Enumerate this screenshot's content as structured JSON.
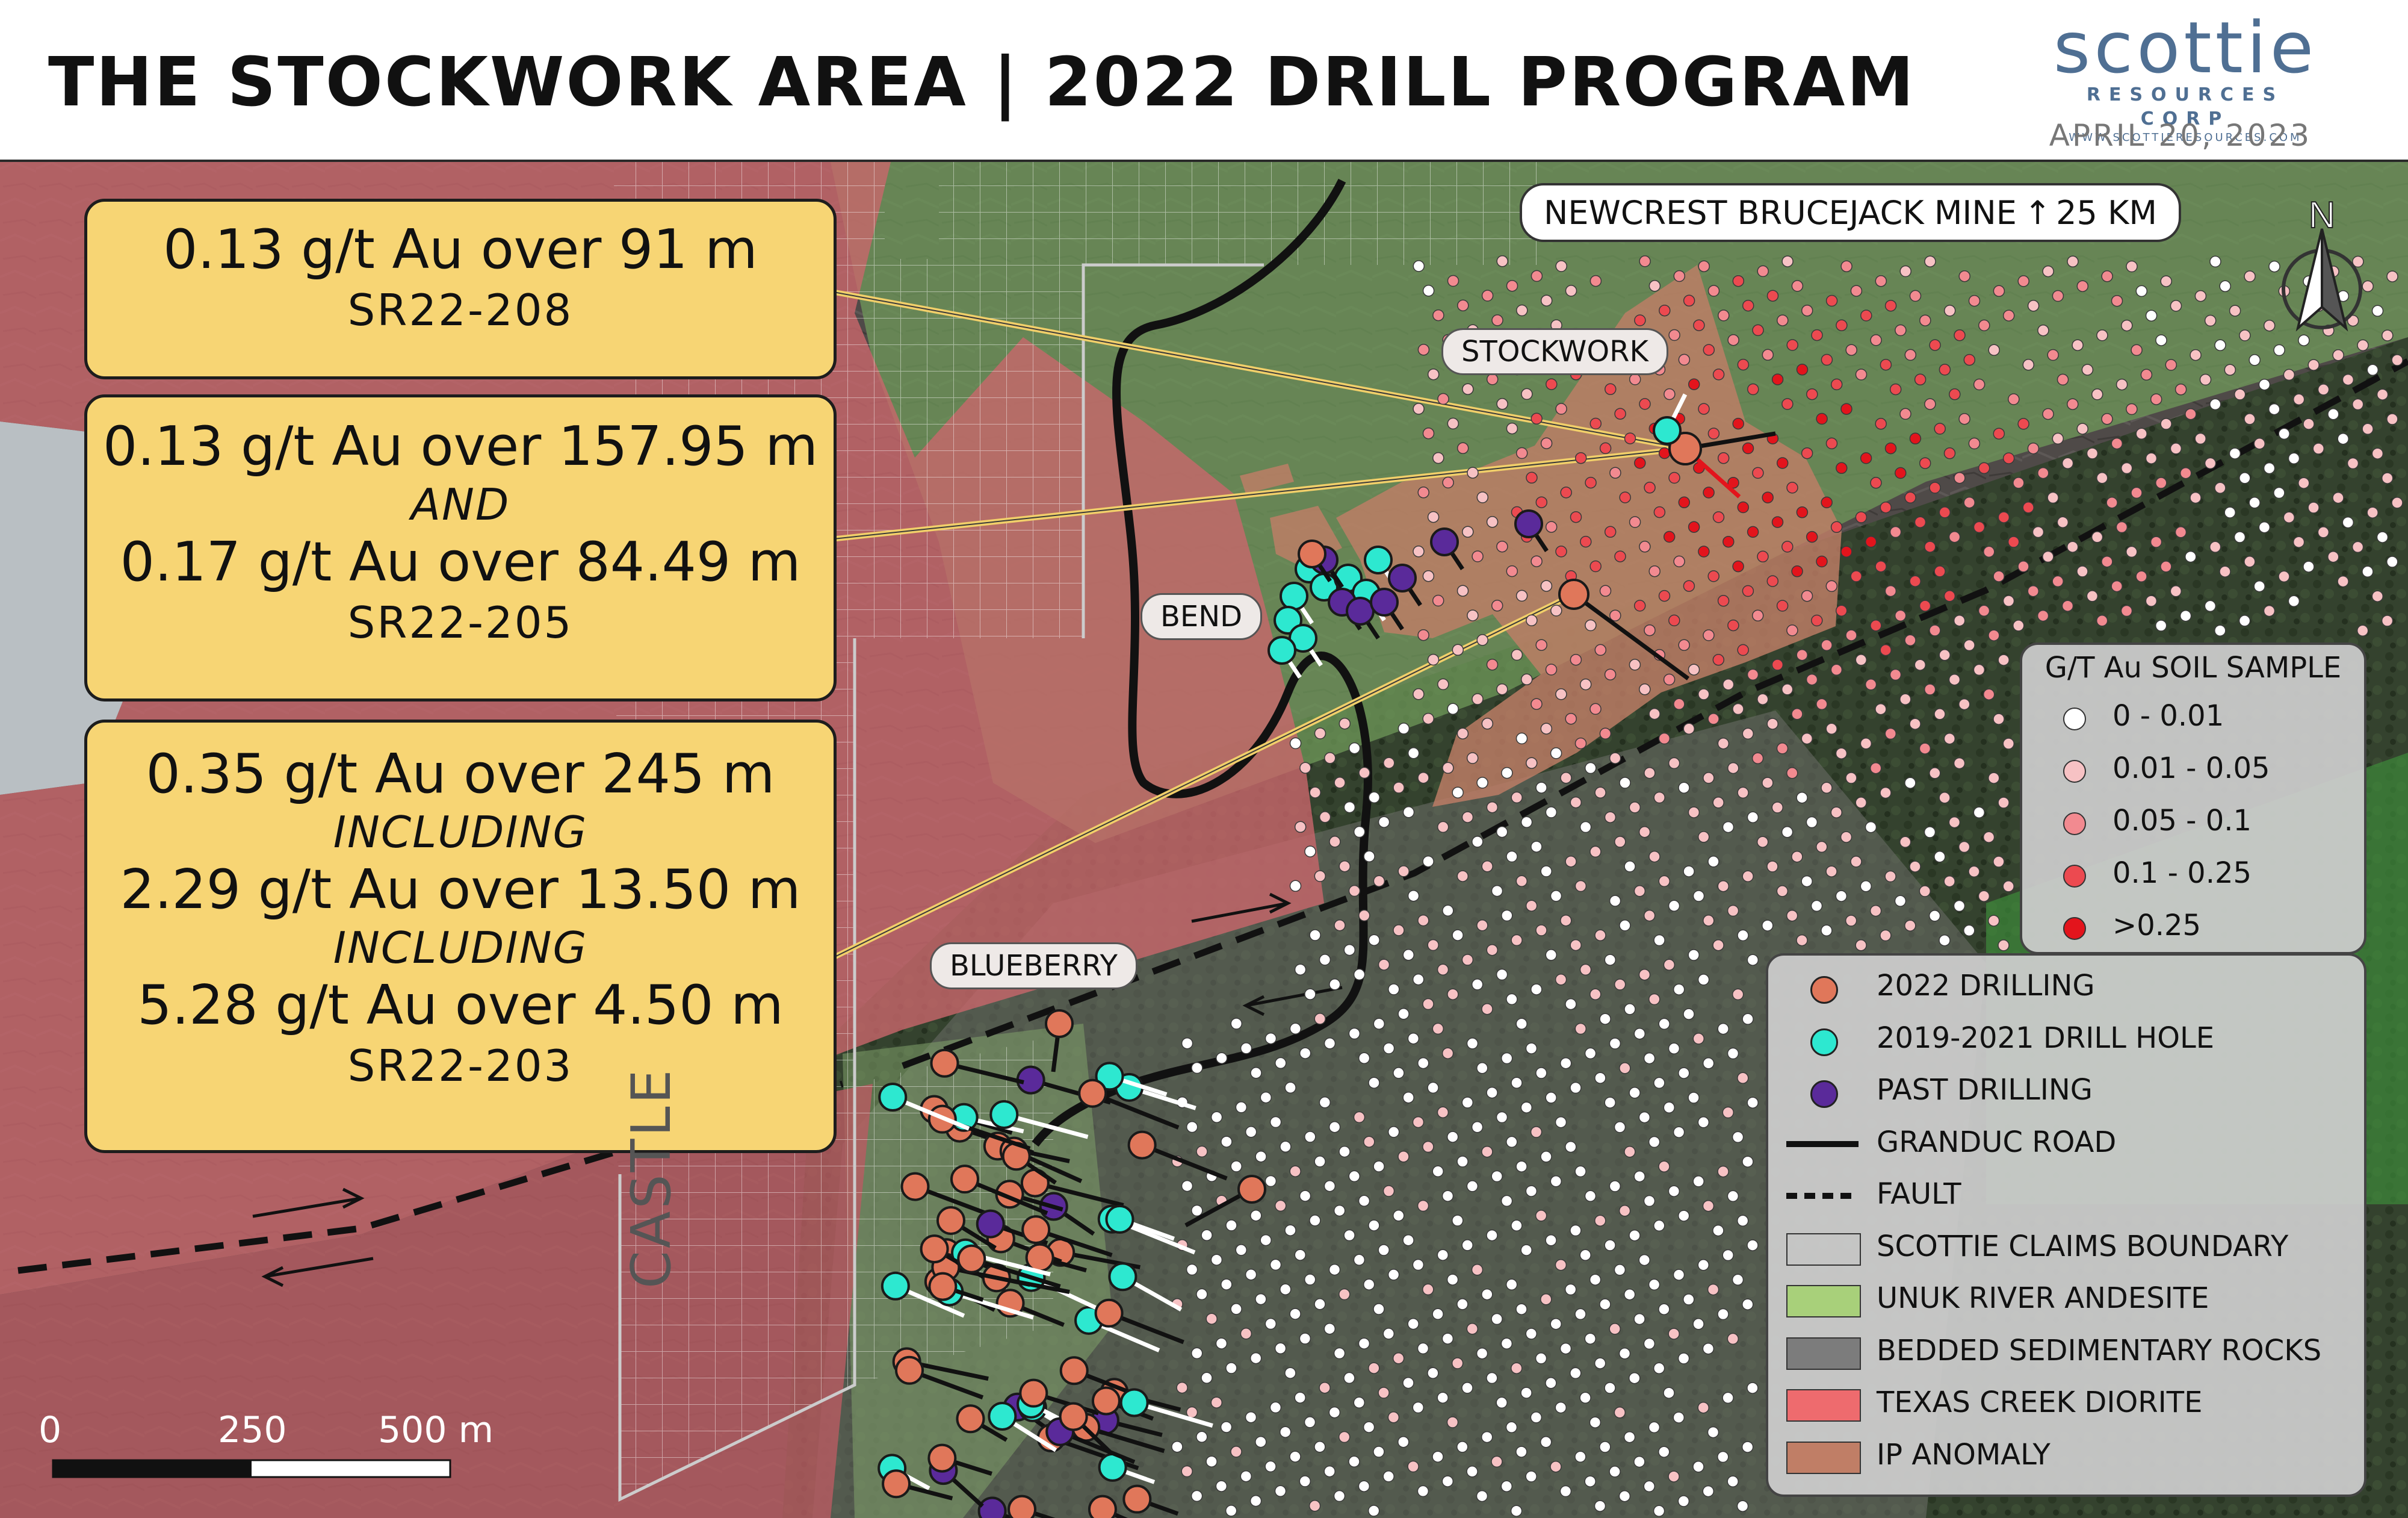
{
  "header": {
    "title": "THE STOCKWORK AREA | 2022 DRILL PROGRAM",
    "logo_word": "scottie",
    "logo_sub": "RESOURCES CORP",
    "logo_url": "WWW.SCOTTIERESOURCES.COM",
    "date": "APRIL 20, 2023"
  },
  "callouts": [
    {
      "lines": [
        "0.13 g/t Au over 91 m"
      ],
      "hole": "SR22-208"
    },
    {
      "lines": [
        "0.13 g/t Au over 157.95 m",
        "AND",
        "0.17 g/t Au over 84.49 m"
      ],
      "hole": "SR22-205"
    },
    {
      "lines": [
        "0.35 g/t Au over 245 m",
        "INCLUDING",
        "2.29 g/t Au over 13.50 m",
        "INCLUDING",
        "5.28 g/t Au over 4.50 m"
      ],
      "hole": "SR22-203"
    }
  ],
  "map_labels": {
    "mine": "NEWCREST BRUCEJACK MINE",
    "mine_arrow": "↑",
    "mine_distance": "25  KM",
    "stockwork": "STOCKWORK",
    "bend": "BEND",
    "blueberry": "BLUEBERRY",
    "castle": "CASTLE",
    "north": "N"
  },
  "scale_bar": {
    "ticks": [
      "0",
      "250",
      "500 m"
    ]
  },
  "soil_legend": {
    "title": "G/T Au SOIL SAMPLE",
    "classes": [
      {
        "label": "0 - 0.01",
        "color": "#ffffff"
      },
      {
        "label": "0.01 - 0.05",
        "color": "#f7c2c4"
      },
      {
        "label": "0.05 - 0.1",
        "color": "#f28a90"
      },
      {
        "label": "0.1 - 0.25",
        "color": "#ec4a50"
      },
      {
        "label": ">0.25",
        "color": "#e3141c"
      }
    ]
  },
  "main_legend": {
    "items": [
      {
        "label": "2022 DRILLING",
        "symbol": "orange-circle",
        "color": "#e0775a"
      },
      {
        "label": "2019-2021  DRILL HOLE",
        "symbol": "cyan-circle",
        "color": "#2de8d0"
      },
      {
        "label": "PAST DRILLING",
        "symbol": "purple-circle",
        "color": "#5a2a9a"
      },
      {
        "label": "GRANDUC ROAD",
        "symbol": "solid-line",
        "color": "#111111"
      },
      {
        "label": "FAULT",
        "symbol": "dashed-line",
        "color": "#111111"
      },
      {
        "label": "SCOTTIE CLAIMS BOUNDARY",
        "symbol": "grid-box",
        "color": "#ffffff"
      },
      {
        "label": "UNUK RIVER ANDESITE",
        "symbol": "fill-box",
        "color": "#a8d07a"
      },
      {
        "label": "BEDDED SEDIMENTARY ROCKS",
        "symbol": "fill-box",
        "color": "#7c7c7c"
      },
      {
        "label": "TEXAS CREEK DIORITE",
        "symbol": "fill-box",
        "color": "#ee6b6e"
      },
      {
        "label": "IP ANOMALY",
        "symbol": "fill-box",
        "color": "#c07e66"
      }
    ]
  },
  "colors": {
    "callout_fill": "#f7d574",
    "drill_2022": "#e0775a",
    "drill_2019_2021": "#2de8d0",
    "past_drilling": "#5a2a9a",
    "diorite": "#ee6b6e",
    "andesite": "#a8d07a",
    "sedimentary": "#7c7c7c",
    "ip_anomaly": "#c07e66"
  }
}
